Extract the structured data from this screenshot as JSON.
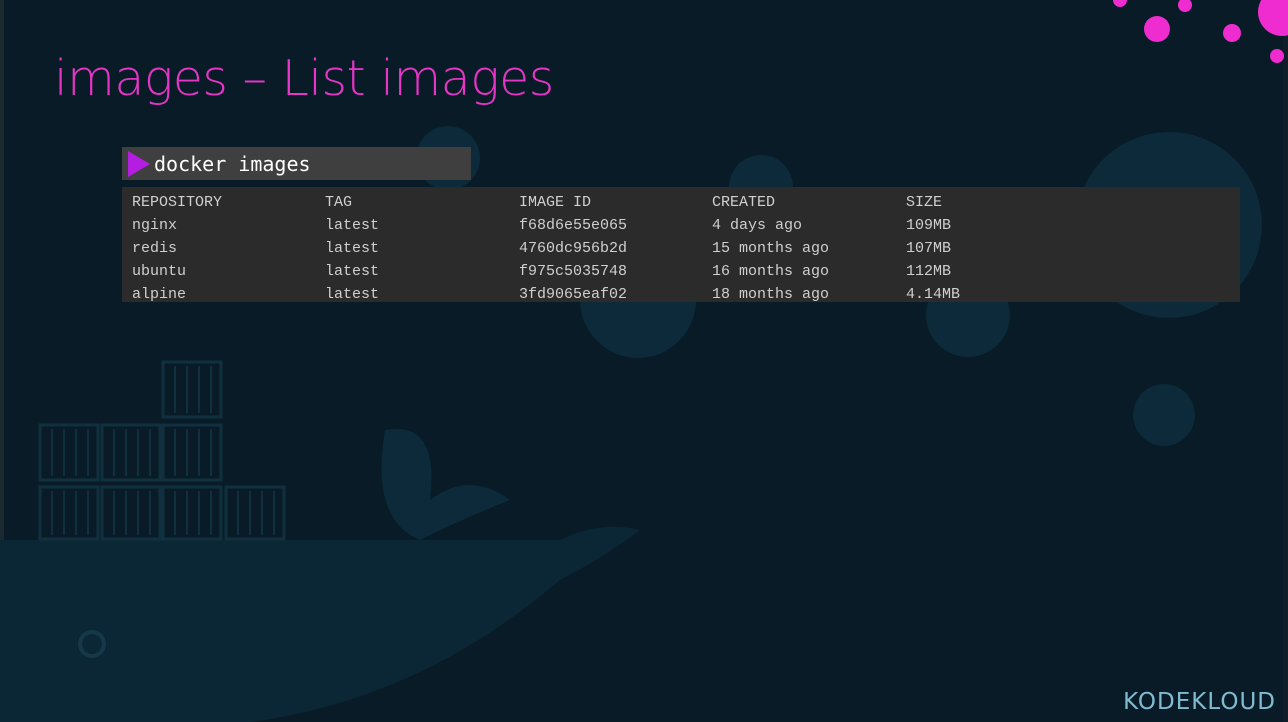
{
  "title": "images – List images",
  "command": {
    "text": "docker images",
    "prompt_icon": "play-triangle-icon",
    "accent": "#b41ee0"
  },
  "output": {
    "headers": [
      "REPOSITORY",
      "TAG",
      "IMAGE ID",
      "CREATED",
      "SIZE"
    ],
    "rows": [
      [
        "nginx",
        "latest",
        "f68d6e55e065",
        "4 days ago",
        "109MB"
      ],
      [
        "redis",
        "latest",
        "4760dc956b2d",
        "15 months ago",
        "107MB"
      ],
      [
        "ubuntu",
        "latest",
        "f975c5035748",
        "16 months ago",
        "112MB"
      ],
      [
        "alpine",
        "latest",
        "3fd9065eaf02",
        "18 months ago",
        "4.14MB"
      ]
    ]
  },
  "logo": {
    "text": "KODEKLOUD"
  },
  "colors": {
    "background": "#081b26",
    "title": "#e535c6",
    "decor_dots": "#ee2ccf",
    "terminal_bar": "#3f3f3f",
    "terminal_output": "#2b2b2b",
    "logo": "#7fbcd2"
  }
}
